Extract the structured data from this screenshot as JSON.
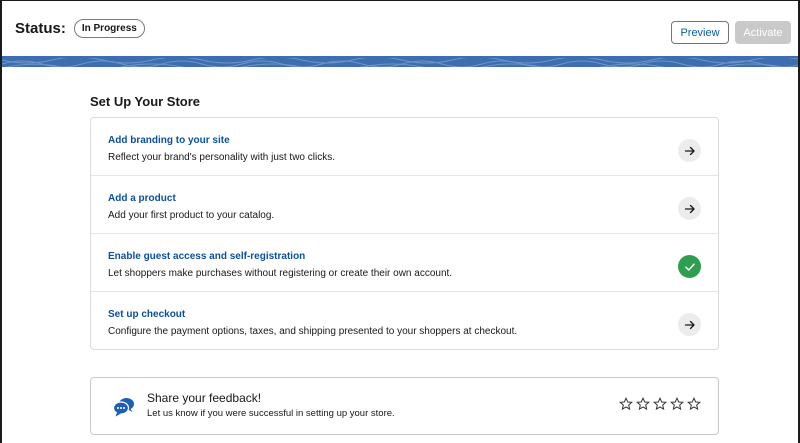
{
  "header": {
    "status_label": "Status:",
    "status_badge": "In Progress",
    "preview_label": "Preview",
    "activate_label": "Activate"
  },
  "setup": {
    "title": "Set Up Your Store",
    "items": [
      {
        "title": "Add branding to your site",
        "desc": "Reflect your brand's personality with just two clicks.",
        "state": "arrow"
      },
      {
        "title": "Add a product",
        "desc": "Add your first product to your catalog.",
        "state": "arrow"
      },
      {
        "title": "Enable guest access and self-registration",
        "desc": "Let shoppers make purchases without registering or create their own account.",
        "state": "done"
      },
      {
        "title": "Set up checkout",
        "desc": "Configure the payment options, taxes, and shipping presented to your shoppers at checkout.",
        "state": "arrow"
      }
    ]
  },
  "feedback": {
    "title": "Share your feedback!",
    "desc": "Let us know if you were successful in setting up your store.",
    "rating": 0,
    "max_rating": 5
  },
  "colors": {
    "link": "#0b4f9e",
    "success": "#2e9e4f",
    "banner": "#3d6fb0",
    "chat_icon": "#1b5fb8"
  },
  "icons": {
    "arrow": "arrow-right-icon",
    "done": "check-icon",
    "chat": "chat-bubbles-icon",
    "star": "star-outline-icon"
  }
}
